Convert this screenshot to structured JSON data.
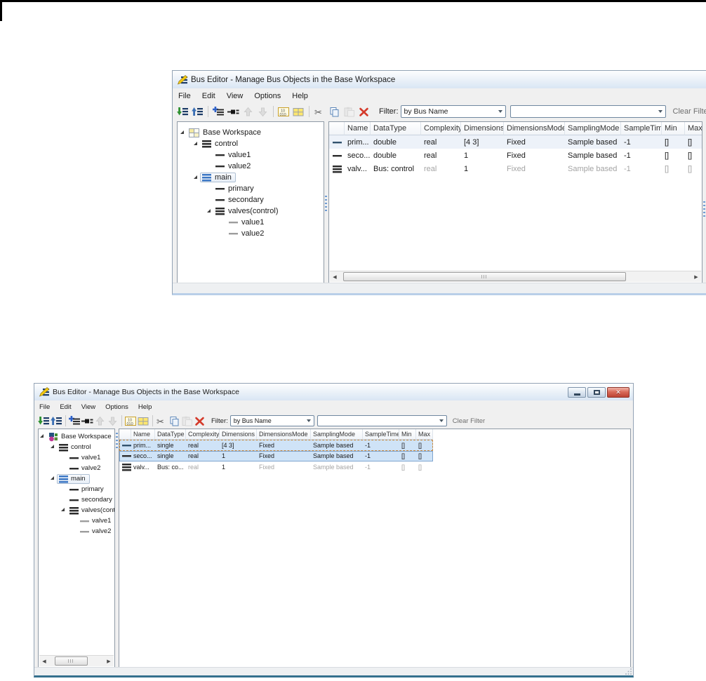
{
  "windows": [
    {
      "id": "top",
      "title": "Bus Editor - Manage Bus Objects in the Base Workspace",
      "menu": [
        "File",
        "Edit",
        "View",
        "Options",
        "Help"
      ],
      "toolbar": {
        "icons": [
          "import",
          "export",
          "separator",
          "add-bus",
          "add-element",
          "move-up",
          "move-down",
          "separator",
          "binary-display",
          "grid-view",
          "separator",
          "cut",
          "copy",
          "paste",
          "delete"
        ],
        "disabled_icons": [
          "move-up",
          "move-down",
          "paste"
        ],
        "filter_label": "Filter:",
        "filter_by_value": "by Bus Name",
        "filter_text_value": "",
        "clear_filter_label": "Clear Filter"
      },
      "tree": [
        {
          "label": "Base Workspace",
          "icon": "workspace-grid-icon",
          "level": 0,
          "expanded": true
        },
        {
          "label": "control",
          "icon": "bus-icon-black",
          "level": 1,
          "expanded": true
        },
        {
          "label": "value1",
          "icon": "element-line-black",
          "level": 2
        },
        {
          "label": "value2",
          "icon": "element-line-black",
          "level": 2
        },
        {
          "label": "main",
          "icon": "bus-icon-blue",
          "level": 1,
          "expanded": true,
          "selected": true
        },
        {
          "label": "primary",
          "icon": "element-line-black",
          "level": 2
        },
        {
          "label": "secondary",
          "icon": "element-line-black",
          "level": 2
        },
        {
          "label": "valves(control)",
          "icon": "bus-icon-black",
          "level": 2,
          "expanded": true
        },
        {
          "label": "value1",
          "icon": "element-line-gray",
          "level": 3
        },
        {
          "label": "value2",
          "icon": "element-line-gray",
          "level": 3
        }
      ],
      "table": {
        "columns": [
          "Name",
          "DataType",
          "Complexity",
          "Dimensions",
          "DimensionsMode",
          "SamplingMode",
          "SampleTime",
          "Min",
          "Max"
        ],
        "rows": [
          {
            "icon": "element-line-dark",
            "state": "highlight",
            "cells": [
              "prim...",
              "double",
              "real",
              "[4 3]",
              "Fixed",
              "Sample based",
              "-1",
              "[]",
              "[]"
            ],
            "gray_cells": []
          },
          {
            "icon": "element-line-black",
            "state": "none",
            "cells": [
              "seco...",
              "double",
              "real",
              "1",
              "Fixed",
              "Sample based",
              "-1",
              "[]",
              "[]"
            ],
            "gray_cells": []
          },
          {
            "icon": "bus-icon-black",
            "state": "none",
            "cells": [
              "valv...",
              "Bus: control",
              "real",
              "1",
              "Fixed",
              "Sample based",
              "-1",
              "[]",
              "[]"
            ],
            "gray_cells": [
              2,
              4,
              5,
              6,
              7,
              8
            ]
          }
        ]
      }
    },
    {
      "id": "bottom",
      "title": "Bus Editor - Manage Bus Objects in the Base Workspace",
      "window_buttons": [
        "minimize",
        "maximize",
        "close"
      ],
      "menu": [
        "File",
        "Edit",
        "View",
        "Options",
        "Help"
      ],
      "toolbar": {
        "icons": [
          "import",
          "export",
          "separator",
          "add-bus",
          "add-element",
          "move-up",
          "move-down",
          "separator",
          "binary-display",
          "grid-view",
          "separator",
          "cut",
          "copy",
          "paste",
          "delete"
        ],
        "disabled_icons": [
          "move-up",
          "move-down",
          "paste"
        ],
        "filter_label": "Filter:",
        "filter_by_value": "by Bus Name",
        "filter_text_value": "",
        "clear_filter_label": "Clear Filter"
      },
      "tree": [
        {
          "label": "Base Workspace",
          "icon": "workspace-sim-icon",
          "level": 0,
          "expanded": true
        },
        {
          "label": "control",
          "icon": "bus-icon-black",
          "level": 1,
          "expanded": true
        },
        {
          "label": "valve1",
          "icon": "element-line-black",
          "level": 2
        },
        {
          "label": "valve2",
          "icon": "element-line-black",
          "level": 2
        },
        {
          "label": "main",
          "icon": "bus-icon-blue",
          "level": 1,
          "expanded": true,
          "selected": true
        },
        {
          "label": "primary",
          "icon": "element-line-black",
          "level": 2
        },
        {
          "label": "secondary",
          "icon": "element-line-black",
          "level": 2
        },
        {
          "label": "valves(control)",
          "icon": "bus-icon-black",
          "level": 2,
          "expanded": true
        },
        {
          "label": "valve1",
          "icon": "element-line-gray",
          "level": 3
        },
        {
          "label": "valve2",
          "icon": "element-line-gray",
          "level": 3
        }
      ],
      "table": {
        "columns": [
          "Name",
          "DataType",
          "Complexity",
          "Dimensions",
          "DimensionsMode",
          "SamplingMode",
          "SampleTime",
          "Min",
          "Max"
        ],
        "rows": [
          {
            "icon": "element-line-dark",
            "state": "focus",
            "cells": [
              "prim...",
              "single",
              "real",
              "[4 3]",
              "Fixed",
              "Sample based",
              "-1",
              "[]",
              "[]"
            ],
            "gray_cells": []
          },
          {
            "icon": "element-line-black",
            "state": "selected",
            "cells": [
              "seco...",
              "single",
              "real",
              "1",
              "Fixed",
              "Sample based",
              "-1",
              "[]",
              "[]"
            ],
            "gray_cells": []
          },
          {
            "icon": "bus-icon-black",
            "state": "none",
            "cells": [
              "valv...",
              "Bus: co...",
              "real",
              "1",
              "Fixed",
              "Sample based",
              "-1",
              "[]",
              "[]"
            ],
            "gray_cells": [
              2,
              4,
              5,
              6,
              7,
              8
            ]
          }
        ]
      }
    }
  ]
}
